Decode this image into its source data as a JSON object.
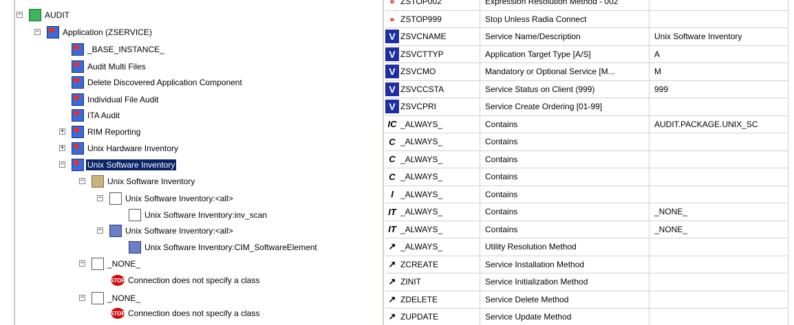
{
  "tree": {
    "nodes": [
      {
        "label": "AUDIT",
        "expander": "−",
        "icon": "group-icon"
      },
      {
        "label": "Application (ZSERVICE)",
        "expander": "−",
        "icon": "application-icon"
      },
      {
        "label": "_BASE_INSTANCE_",
        "expander": "",
        "icon": "application-icon"
      },
      {
        "label": "Audit Multi Files",
        "expander": "",
        "icon": "application-icon"
      },
      {
        "label": "Delete Discovered Application Component",
        "expander": "",
        "icon": "application-icon"
      },
      {
        "label": "Individual File Audit",
        "expander": "",
        "icon": "application-icon"
      },
      {
        "label": "ITA Audit",
        "expander": "",
        "icon": "application-icon"
      },
      {
        "label": "RIM Reporting",
        "expander": "+",
        "icon": "application-icon"
      },
      {
        "label": "Unix Hardware Inventory",
        "expander": "+",
        "icon": "application-icon"
      },
      {
        "label": "Unix Software Inventory",
        "expander": "−",
        "icon": "application-icon",
        "selected": true
      },
      {
        "label": "Unix Software Inventory",
        "expander": "−",
        "icon": "package-icon"
      },
      {
        "label": "Unix Software Inventory:<all>",
        "expander": "−",
        "icon": "file-icon"
      },
      {
        "label": "Unix Software Inventory:inv_scan",
        "expander": "",
        "icon": "file-icon"
      },
      {
        "label": "Unix Software Inventory:<all>",
        "expander": "−",
        "icon": "monitor-icon"
      },
      {
        "label": "Unix Software Inventory:CIM_SoftwareElement",
        "expander": "",
        "icon": "monitor-icon"
      },
      {
        "label": "_NONE_",
        "expander": "−",
        "icon": "file-icon"
      },
      {
        "label": "Connection does not specify a class",
        "expander": "",
        "icon": "stop-icon"
      },
      {
        "label": "_NONE_",
        "expander": "−",
        "icon": "file-icon"
      },
      {
        "label": "Connection does not specify a class",
        "expander": "",
        "icon": "stop-icon"
      }
    ],
    "stop_text": "STOP"
  },
  "grid": {
    "rows": [
      {
        "name": "ZSTOP002",
        "desc": "Expression Resolution Method - 002",
        "value": "",
        "icon": "expression-icon",
        "glyph": "»"
      },
      {
        "name": "ZSTOP999",
        "desc": "Stop Unless Radia Connect",
        "value": "",
        "icon": "expression-icon",
        "glyph": "»"
      },
      {
        "name": "ZSVCNAME",
        "desc": "Service Name/Description",
        "value": "Unix Software Inventory",
        "icon": "variable-icon",
        "glyph": "V"
      },
      {
        "name": "ZSVCTTYP",
        "desc": "Application Target Type [A/S]",
        "value": "A",
        "icon": "variable-icon",
        "glyph": "V"
      },
      {
        "name": "ZSVCMO",
        "desc": "Mandatory or Optional Service [M...",
        "value": "M",
        "icon": "variable-icon",
        "glyph": "V"
      },
      {
        "name": "ZSVCCSTA",
        "desc": "Service Status on Client (999)",
        "value": "999",
        "icon": "variable-icon",
        "glyph": "V"
      },
      {
        "name": "ZSVCPRI",
        "desc": "Service Create Ordering [01-99]",
        "value": "",
        "icon": "variable-icon",
        "glyph": "V"
      },
      {
        "name": "_ALWAYS_",
        "desc": "Contains",
        "value": "AUDIT.PACKAGE.UNIX_SC",
        "icon": "connection-icon",
        "glyph": "IC"
      },
      {
        "name": "_ALWAYS_",
        "desc": "Contains",
        "value": "",
        "icon": "connection-icon",
        "glyph": "C"
      },
      {
        "name": "_ALWAYS_",
        "desc": "Contains",
        "value": "",
        "icon": "connection-icon",
        "glyph": "C"
      },
      {
        "name": "_ALWAYS_",
        "desc": "Contains",
        "value": "",
        "icon": "connection-icon",
        "glyph": "C"
      },
      {
        "name": "_ALWAYS_",
        "desc": "Contains",
        "value": "",
        "icon": "connection-icon",
        "glyph": "I"
      },
      {
        "name": "_ALWAYS_",
        "desc": "Contains",
        "value": "_NONE_",
        "icon": "connection-icon",
        "glyph": "IT"
      },
      {
        "name": "_ALWAYS_",
        "desc": "Contains",
        "value": "_NONE_",
        "icon": "connection-icon",
        "glyph": "IT"
      },
      {
        "name": "_ALWAYS_",
        "desc": "Utility Resolution Method",
        "value": "",
        "icon": "method-icon",
        "glyph": "↗"
      },
      {
        "name": "ZCREATE",
        "desc": "Service Installation Method",
        "value": "",
        "icon": "method-icon",
        "glyph": "↗"
      },
      {
        "name": "ZINIT",
        "desc": "Service Initialization Method",
        "value": "",
        "icon": "method-icon",
        "glyph": "↗"
      },
      {
        "name": "ZDELETE",
        "desc": "Service Delete Method",
        "value": "",
        "icon": "method-icon",
        "glyph": "↗"
      },
      {
        "name": "ZUPDATE",
        "desc": "Service Update Method",
        "value": "",
        "icon": "method-icon",
        "glyph": "↗"
      }
    ]
  }
}
